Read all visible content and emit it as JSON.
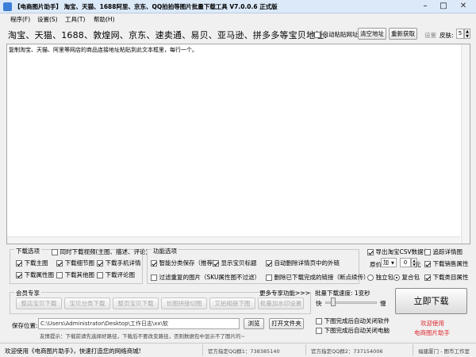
{
  "window": {
    "title": "【电商图片助手】 淘宝、天猫、1688阿里、京东、QQ拍拍等图片批量下载工具 V7.0.0.6 正式版",
    "minimize": "–",
    "maximize": "□",
    "close": "✕"
  },
  "menu": [
    "程序(F)",
    "设置(S)",
    "工具(T)",
    "帮助(H)"
  ],
  "toolbar": {
    "address_label": "淘宝、天猫、1688、敦煌网、京东、速卖通、易贝、亚马逊、拼多多等宝贝地址:",
    "auto_paste": "自动粘贴网址",
    "clear_button": "清空地址",
    "recognize_button": "重新获取",
    "settings_label": "设置",
    "skin_label": "皮肤:",
    "skin_value": "5"
  },
  "url_box": {
    "placeholder": "复制淘宝、天猫、阿里等网店的商品连接地址粘贴到此文本框里，每行一个。"
  },
  "download_options": {
    "title": "下载选项",
    "items": [
      {
        "label": "同时下载视频(主图、描述、评论)",
        "checked": false
      },
      {
        "label": "下载主图",
        "checked": true
      },
      {
        "label": "下载细节图",
        "checked": true
      },
      {
        "label": "下载手机详情",
        "checked": true
      },
      {
        "label": "下载属性图",
        "checked": true
      },
      {
        "label": "下载其他图",
        "checked": false
      },
      {
        "label": "下载评论图",
        "checked": false
      }
    ]
  },
  "function_options": {
    "title": "功能选项",
    "items": [
      {
        "label": "智能分类保存（推荐）",
        "checked": true
      },
      {
        "label": "显示宝贝标题",
        "checked": true
      },
      {
        "label": "自动删除详情页中的外链",
        "checked": true
      },
      {
        "label": "过滤重复的图片（SKU属性图不过滤）",
        "checked": false
      },
      {
        "label": "删除已下载完成的链接（断点续传）",
        "checked": false
      }
    ]
  },
  "right_options": {
    "export_csv": {
      "label": "导出淘宝CSV数据包",
      "checked": true
    },
    "desc_details": {
      "label": "追踪详情图",
      "checked": false
    },
    "price_label": "原价",
    "price_mode": "加",
    "price_value": "0",
    "price_unit": "元",
    "download_sales_attr": {
      "label": "下载销售属性",
      "checked": true
    },
    "pack_options": [
      {
        "label": "独立包",
        "checked": false
      },
      {
        "label": "复合包",
        "checked": true
      }
    ],
    "download_category_attr": {
      "label": "下载类目属性",
      "checked": true
    }
  },
  "member_zone": {
    "title": "会员专享",
    "more_link": "更多专享功能>>>",
    "buttons": [
      "整店宝贝下载",
      "宝贝分类下载",
      "整页宝贝下载",
      "长图拼接切图",
      "又拍相册下图",
      "批量加水印设置"
    ]
  },
  "batch": {
    "speed_label": "批量下载速度: 1变秒",
    "fast": "快",
    "slow": "慢",
    "speed_level": 0.12
  },
  "start_button": "立即下载",
  "welcome_link": "欢迎使用",
  "app_name_link": "电商图片助手",
  "save_path": {
    "label": "保存位置:",
    "value": "C:\\Users\\Administrator\\Desktop\\工作日志\\xx\\软",
    "browse_button": "浏览",
    "open_button": "打开文件夹",
    "hint": "友情提示：下载前请先选择好路径，下载后不要改变路径，否则数据包中显示不了图片的~"
  },
  "after_complete": [
    {
      "label": "下图完成后自动关闭软件",
      "checked": false
    },
    {
      "label": "下图完成后自动关闭电脑",
      "checked": false
    }
  ],
  "status": {
    "welcome": "欢迎使用《电商图片助手》，快速打造您的网络商城!",
    "qq1": "官方指定QQ群1：738385140",
    "qq2": "官方指定QQ群2：737154006",
    "studio": "福建厦门 - 图币工作室"
  },
  "colors": {
    "accent_red": "#e0282d",
    "link_blue": "#1a4fbf",
    "titlebar": "#dce9f8"
  }
}
